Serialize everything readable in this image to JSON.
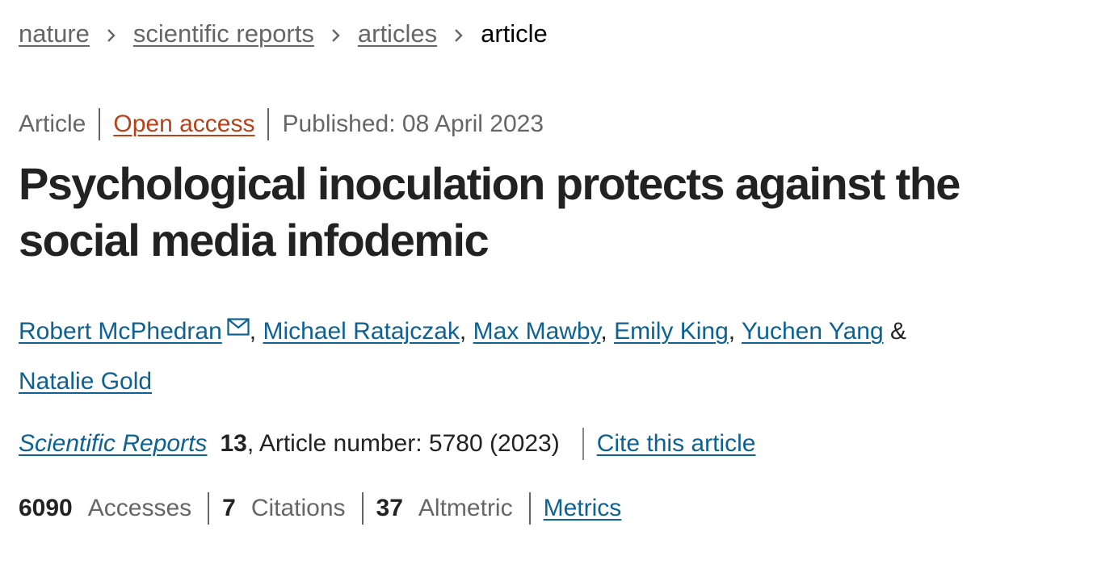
{
  "breadcrumb": {
    "items": [
      {
        "label": "nature"
      },
      {
        "label": "scientific reports"
      },
      {
        "label": "articles"
      }
    ],
    "current": "article"
  },
  "meta": {
    "type": "Article",
    "access": "Open access",
    "published": "Published: 08 April 2023",
    "access_color": "#b7411a"
  },
  "title": "Psychological inoculation protects against the social media infodemic",
  "authors": [
    {
      "name": "Robert McPhedran"
    },
    {
      "name": "Michael Ratajczak"
    },
    {
      "name": "Max Mawby"
    },
    {
      "name": "Emily King"
    },
    {
      "name": "Yuchen Yang"
    },
    {
      "name": "Natalie Gold"
    }
  ],
  "author_separator": ", ",
  "author_last_joiner": " &",
  "contact_icon": "mail-icon",
  "link_color": "#0e6293",
  "journal": {
    "name": "Scientific Reports",
    "volume": "13",
    "article_info": ", Article number: 5780 (2023)",
    "cite_label": "Cite this article"
  },
  "metrics": {
    "accesses": {
      "value": "6090",
      "label": "Accesses"
    },
    "citations": {
      "value": "7",
      "label": "Citations"
    },
    "altmetric": {
      "value": "37",
      "label": "Altmetric"
    },
    "link_label": "Metrics"
  }
}
